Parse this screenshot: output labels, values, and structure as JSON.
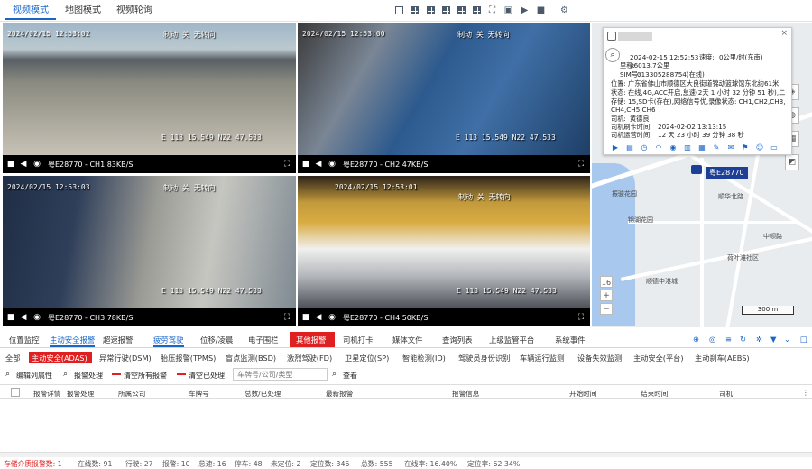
{
  "top_tabs": [
    "视频模式",
    "地图模式",
    "视频轮询"
  ],
  "videos": [
    {
      "timestamp": "2024/02/15 12:53:02",
      "location": "E 113 15.549 N22 47.533",
      "plate": "粤E28770",
      "caption": "粤E28770 - CH1 83KB/S",
      "overlay": "制动 关 无转向"
    },
    {
      "timestamp": "2024/02/15 12:53:00",
      "location": "E 113 15.549 N22 47.533",
      "plate": "粤E28770",
      "caption": "粤E28770 - CH2 47KB/S",
      "overlay": "制动 关 无转向"
    },
    {
      "timestamp": "2024/02/15 12:53:03",
      "location": "E 113 15.549 N22 47.533",
      "plate": "粤E28770",
      "caption": "粤E28770 - CH3 78KB/S",
      "overlay": "制动 关 无转向"
    },
    {
      "timestamp": "2024/02/15 12:53:01",
      "location": "E 113 15.549 N22 47.533",
      "plate": "粤E28770",
      "caption": "粤E28770 - CH4 50KB/S",
      "overlay": "制动 关 无转向"
    }
  ],
  "popup": {
    "time_value": "2024-02-15 12:52:53",
    "speed_label": "速度:",
    "speed_value": "0公里/时(东南)",
    "mileage_label": "里程:",
    "mileage_value": "36013.7公里",
    "sim_label": "SIM号:",
    "sim_value": "013305288754(在线)",
    "position_label": "位置:",
    "position_value": "广东省佛山市顺德区大良街道锦动篮球馆东北约61米",
    "state_label": "状态:",
    "state_value": "在线,4G,ACC开启,怠速(2天 1 小时 32 分钟 51 秒),二",
    "storage_label": "存储:",
    "storage_value": "15,SD卡(存在),网络信号优,录像状态: CH1,CH2,CH3,",
    "storage_value2": "CH4,CH5,CH6",
    "driver_label": "司机:",
    "driver_value": "黄德良",
    "card_time_label": "司机刷卡时间:",
    "card_time_value": "2024-02-02 13:13:15",
    "drive_time_label": "司机运营时间:",
    "drive_time_value": "12 天 23 小时 39 分钟 38 秒"
  },
  "map": {
    "vehicle": "粤E28770",
    "zoom": "16",
    "scale": "300 m",
    "labels": [
      "中顺路",
      "顺德锦鸿",
      "新中港路",
      "中顺路",
      "中顺路",
      "中顺路",
      "德胜公路",
      "丰乐街",
      "振骏花园",
      "顺华北路",
      "锦湖花园",
      "德阳路",
      "荷叶滩社区",
      "顺德中港城",
      "广发银行",
      "大洲路",
      "莲花山",
      "顺德汇港路",
      "德政路",
      "德胜东路"
    ]
  },
  "bottom_tabs": [
    "位置监控",
    "主动安全报警",
    "超速报警",
    "疲劳驾驶",
    "位移/凌晨",
    "电子围栏",
    "其他报警",
    "司机打卡",
    "媒体文件",
    "查询列表",
    "上级监管平台",
    "系统事件"
  ],
  "sub_tabs": [
    "全部",
    "主动安全(ADAS)",
    "异常行驶(DSM)",
    "胎压报警(TPMS)",
    "盲点监测(BSD)",
    "激烈驾驶(FD)",
    "卫星定位(SP)",
    "智能检测(ID)",
    "驾驶员身份识别",
    "车辆运行监测",
    "设备失效监测",
    "主动安全(平台)",
    "主动刹车(AEBS)"
  ],
  "toolbar": {
    "edit": "编辑列属性",
    "handle": "报警处理",
    "clear_all": "清空所有报警",
    "clear_done": "清空已处理",
    "search_placeholder": "车牌号/公司/类型",
    "search_button": "查看"
  },
  "table_headers": [
    "报警详情",
    "报警处理",
    "所属公司",
    "车牌号",
    "总数/已处理",
    "最新报警",
    "报警信息",
    "开始时间",
    "结束时间",
    "司机"
  ],
  "status": {
    "storage_alarm": "存储介质报警数: 1",
    "online": "在线数: 91",
    "moving": "行驶: 27",
    "alarm": "报警: 10",
    "idle": "怠速: 16",
    "parked": "停车: 48",
    "unlocated": "未定位: 2",
    "located": "定位数: 346",
    "total": "总数: 555",
    "online_rate": "在线率: 16.40%",
    "located_rate": "定位率: 62.34%"
  },
  "colors": {
    "accent": "#1a66c7",
    "alert": "#e02020"
  }
}
